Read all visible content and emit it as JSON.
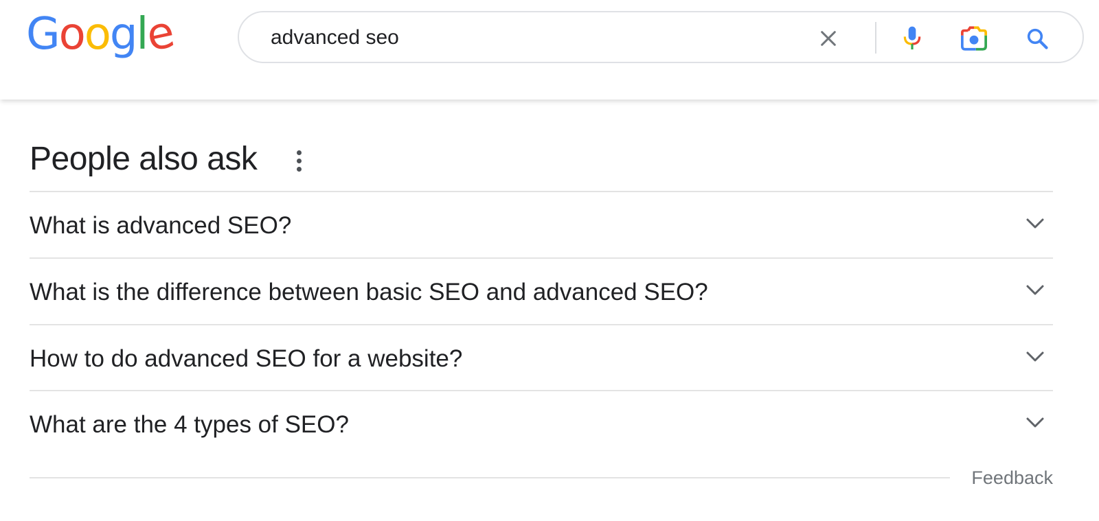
{
  "logo": {
    "letters": [
      {
        "char": "G",
        "color": "#4285F4"
      },
      {
        "char": "o",
        "color": "#EA4335"
      },
      {
        "char": "o",
        "color": "#FBBC05"
      },
      {
        "char": "g",
        "color": "#4285F4"
      },
      {
        "char": "l",
        "color": "#34A853"
      },
      {
        "char": "e",
        "color": "#EA4335"
      }
    ]
  },
  "search": {
    "query": "advanced seo",
    "icons": [
      "clear-icon",
      "microphone-icon",
      "camera-lens-icon",
      "search-icon"
    ]
  },
  "people_also_ask": {
    "heading": "People also ask",
    "menu_icon": "kebab-menu-icon",
    "questions": [
      {
        "text": "What is advanced SEO?",
        "icon": "chevron-down-icon"
      },
      {
        "text": "What is the difference between basic SEO and advanced SEO?",
        "icon": "chevron-down-icon"
      },
      {
        "text": "How to do advanced SEO for a website?",
        "icon": "chevron-down-icon"
      },
      {
        "text": "What are the 4 types of SEO?",
        "icon": "chevron-down-icon"
      }
    ],
    "feedback_label": "Feedback"
  },
  "colors": {
    "blue": "#4285F4",
    "red": "#EA4335",
    "yellow": "#FBBC05",
    "green": "#34A853",
    "text": "#202124",
    "muted": "#70757a",
    "divider": "#e3e3e3"
  }
}
